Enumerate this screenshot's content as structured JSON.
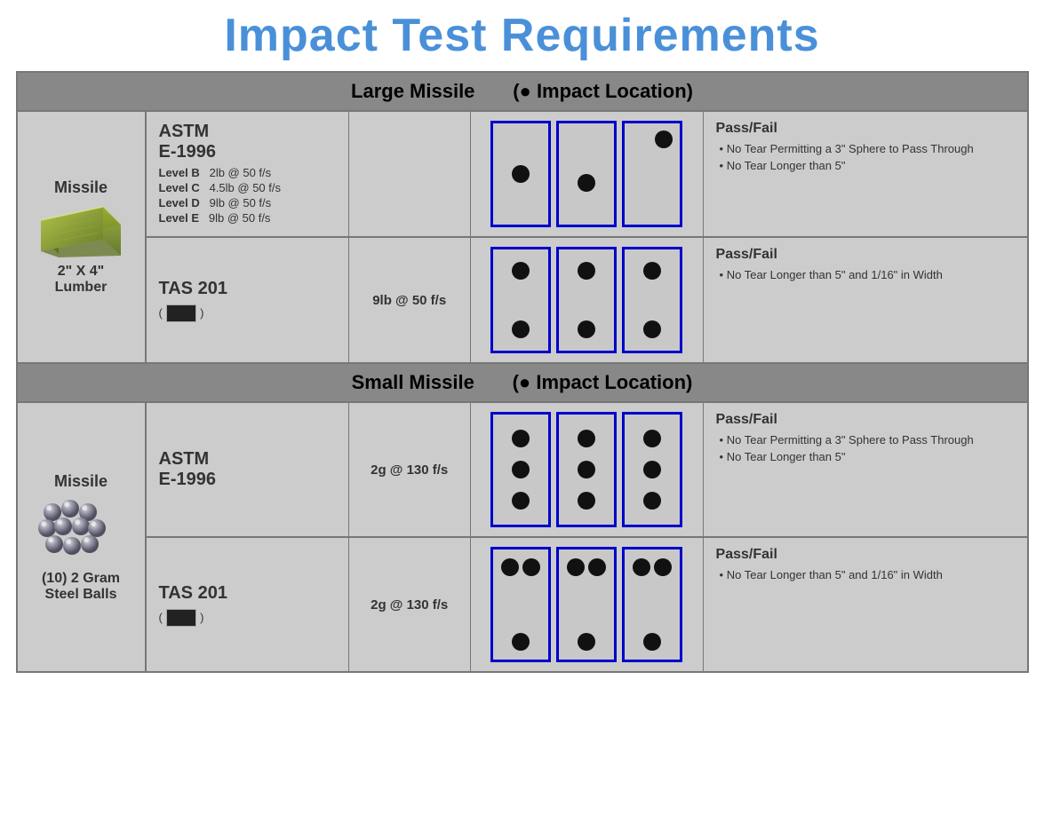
{
  "title": "Impact Test Requirements",
  "large_missile_header": "Large Missile",
  "large_missile_impact": "(● Impact Location)",
  "small_missile_header": "Small Missile",
  "small_missile_impact": "(● Impact Location)",
  "missile_label": "Missile",
  "lumber_size": "2\" X 4\"\nLumber",
  "steel_balls_label": "(10) 2 Gram\nSteel Balls",
  "large_sections": [
    {
      "standard": "ASTM\nE-1996",
      "levels": [
        {
          "level": "Level B",
          "spec": "2lb @ 50 f/s"
        },
        {
          "level": "Level C",
          "spec": "4.5lb @ 50 f/s"
        },
        {
          "level": "Level D",
          "spec": "9lb @ 50 f/s"
        },
        {
          "level": "Level E",
          "spec": "9lb @ 50 f/s"
        }
      ],
      "spec_single": null,
      "diagrams": [
        {
          "dots": [
            "center"
          ]
        },
        {
          "dots": [
            "center-bottom"
          ]
        },
        {
          "dots": [
            "top-right"
          ]
        }
      ],
      "passfail_title": "Pass/Fail",
      "passfail_items": [
        "No Tear Permitting a 3\" Sphere to Pass Through",
        "No Tear Longer than 5\""
      ],
      "has_tas": false
    },
    {
      "standard": "TAS 201",
      "levels": null,
      "spec_single": "9lb @ 50 f/s",
      "diagrams": [
        {
          "dots": [
            "center",
            "bottom-center"
          ]
        },
        {
          "dots": [
            "center",
            "bottom-center"
          ]
        },
        {
          "dots": [
            "center",
            "bottom-center"
          ]
        }
      ],
      "passfail_title": "Pass/Fail",
      "passfail_items": [
        "No Tear Longer than 5\" and 1/16\" in Width"
      ],
      "has_tas": true
    }
  ],
  "small_sections": [
    {
      "standard": "ASTM\nE-1996",
      "spec_single": "2g @ 130 f/s",
      "diagrams": [
        {
          "dots": [
            "top",
            "middle",
            "bottom"
          ]
        },
        {
          "dots": [
            "top",
            "middle",
            "bottom"
          ]
        },
        {
          "dots": [
            "top",
            "middle",
            "bottom"
          ]
        }
      ],
      "passfail_title": "Pass/Fail",
      "passfail_items": [
        "No Tear Permitting a 3\" Sphere to Pass Through",
        "No Tear Longer than 5\""
      ],
      "has_tas": false
    },
    {
      "standard": "TAS 201",
      "spec_single": "2g @ 130 f/s",
      "diagrams": [
        {
          "dots": [
            "double-top",
            "bottom-single"
          ]
        },
        {
          "dots": [
            "double-top",
            "bottom-single"
          ]
        },
        {
          "dots": [
            "double-top",
            "bottom-single"
          ]
        }
      ],
      "passfail_title": "Pass/Fail",
      "passfail_items": [
        "No Tear Longer than 5\" and 1/16\" in Width"
      ],
      "has_tas": true
    }
  ]
}
